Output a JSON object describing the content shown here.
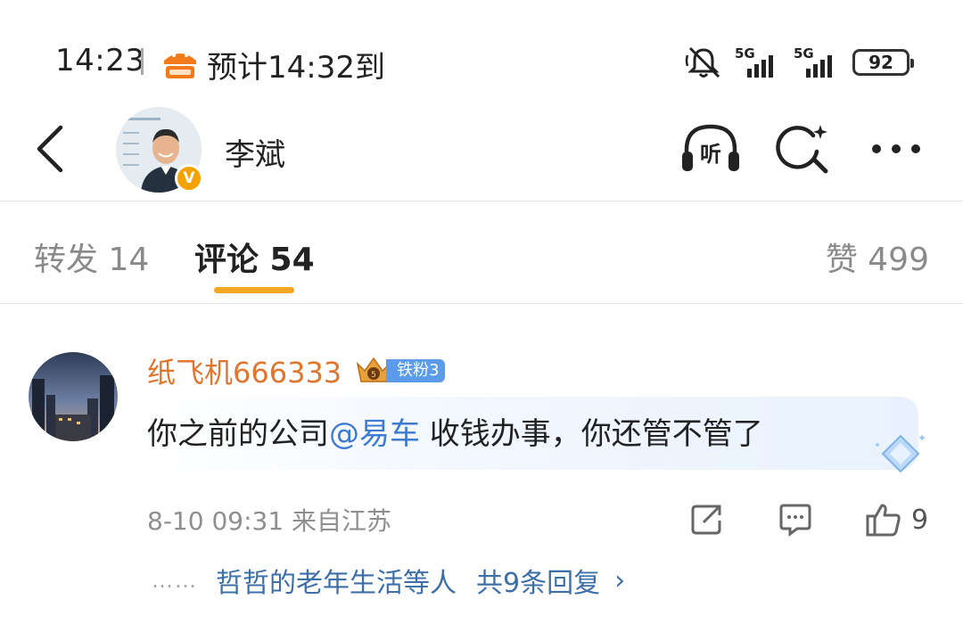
{
  "status_bar": {
    "time": "14:23",
    "eta": "预计14:32到",
    "app_icon": "food-delivery-icon",
    "signal1_label": "5G",
    "signal2_label": "5G",
    "battery": "92",
    "icons": [
      "mute-icon",
      "signal-icon",
      "signal-icon",
      "battery-icon"
    ]
  },
  "header": {
    "user_name": "李斌",
    "verified_badge": "V",
    "icons": [
      "back-icon",
      "listen-icon",
      "search-icon",
      "more-icon"
    ],
    "listen_label": "听"
  },
  "tabs": {
    "repost": "转发 14",
    "comment": "评论 54",
    "like": "赞 499",
    "active": "comment",
    "accent_color": "#f5a623"
  },
  "comment": {
    "author": "纸飞机666333",
    "fan_badge": "铁粉3",
    "text_before": "你之前的公司",
    "mention": "@易车",
    "text_after": " 收钱办事，你还管不管了",
    "meta": "8-10 09:31 来自江苏",
    "like_count": "9",
    "reply_users": "哲哲的老年生活等人",
    "reply_count": "共9条回复",
    "reply_chevron": "›",
    "reply_dots": "……",
    "name_color": "#e0752d",
    "link_color": "#3d7bd0"
  }
}
